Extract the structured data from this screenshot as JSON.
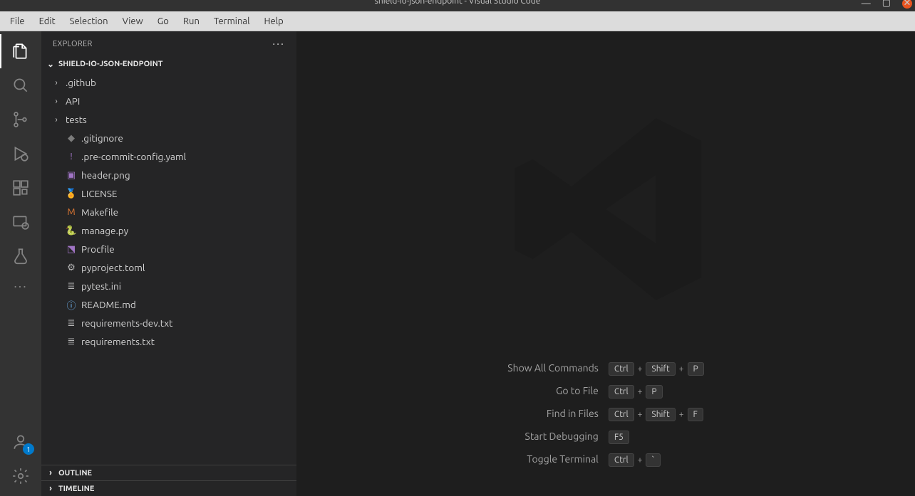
{
  "titlebar": {
    "title": "shield-io-json-endpoint - Visual Studio Code"
  },
  "menubar": [
    "File",
    "Edit",
    "Selection",
    "View",
    "Go",
    "Run",
    "Terminal",
    "Help"
  ],
  "explorer": {
    "title": "EXPLORER",
    "project": "SHIELD-IO-JSON-ENDPOINT",
    "folders": [
      {
        "name": ".github"
      },
      {
        "name": "API"
      },
      {
        "name": "tests"
      }
    ],
    "files": [
      {
        "name": ".gitignore",
        "icon": "git-icon",
        "cls": "c-gitignore",
        "glyph": "◆"
      },
      {
        "name": ".pre-commit-config.yaml",
        "icon": "yaml-icon",
        "cls": "c-purple",
        "glyph": "!"
      },
      {
        "name": "header.png",
        "icon": "image-icon",
        "cls": "c-purple",
        "glyph": "▣"
      },
      {
        "name": "LICENSE",
        "icon": "license-icon",
        "cls": "c-yellow",
        "glyph": "🏅"
      },
      {
        "name": "Makefile",
        "icon": "makefile-icon",
        "cls": "c-orange",
        "glyph": "M"
      },
      {
        "name": "manage.py",
        "icon": "python-icon",
        "cls": "c-blue",
        "glyph": "🐍"
      },
      {
        "name": "Procfile",
        "icon": "heroku-icon",
        "cls": "c-heroku",
        "glyph": "⬔"
      },
      {
        "name": "pyproject.toml",
        "icon": "toml-icon",
        "cls": "c-gear",
        "glyph": "⚙"
      },
      {
        "name": "pytest.ini",
        "icon": "ini-icon",
        "cls": "c-lines",
        "glyph": "≣"
      },
      {
        "name": "README.md",
        "icon": "info-icon",
        "cls": "c-info",
        "glyph": "ⓘ"
      },
      {
        "name": "requirements-dev.txt",
        "icon": "text-icon",
        "cls": "c-lines",
        "glyph": "≣"
      },
      {
        "name": "requirements.txt",
        "icon": "text-icon",
        "cls": "c-lines",
        "glyph": "≣"
      }
    ],
    "outline": "OUTLINE",
    "timeline": "TIMELINE"
  },
  "accounts_badge": "1",
  "shortcuts": [
    {
      "label": "Show All Commands",
      "keys": [
        "Ctrl",
        "Shift",
        "P"
      ]
    },
    {
      "label": "Go to File",
      "keys": [
        "Ctrl",
        "P"
      ]
    },
    {
      "label": "Find in Files",
      "keys": [
        "Ctrl",
        "Shift",
        "F"
      ]
    },
    {
      "label": "Start Debugging",
      "keys": [
        "F5"
      ]
    },
    {
      "label": "Toggle Terminal",
      "keys": [
        "Ctrl",
        "`"
      ]
    }
  ]
}
